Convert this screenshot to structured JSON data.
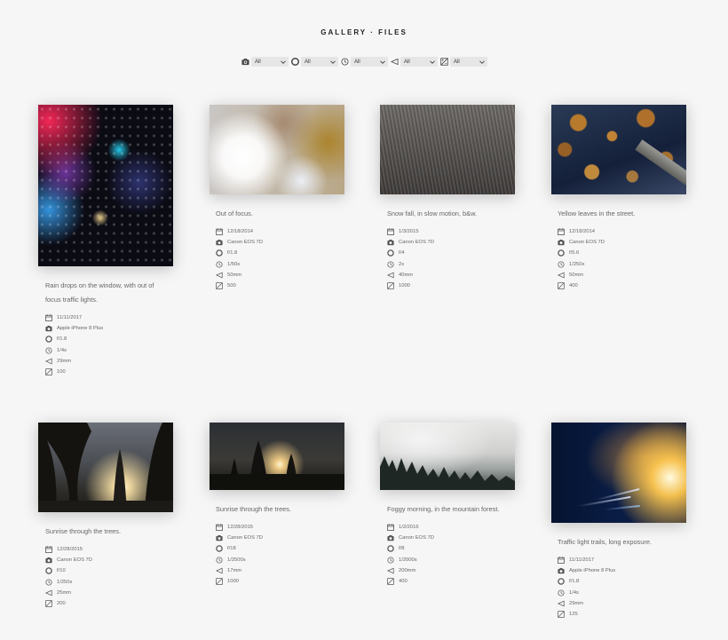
{
  "page": {
    "title": "GALLERY · FILES"
  },
  "filters": [
    {
      "icon": "camera-icon",
      "value": "All"
    },
    {
      "icon": "aperture-icon",
      "value": "All"
    },
    {
      "icon": "timer-icon",
      "value": "All"
    },
    {
      "icon": "focal-length-icon",
      "value": "All"
    },
    {
      "icon": "iso-icon",
      "value": "All"
    }
  ],
  "photos": [
    {
      "caption": "Rain drops on the window, with out of focus traffic lights.",
      "date": "11/11/2017",
      "camera": "Apple iPhone 8 Plus",
      "aperture": "f/1.8",
      "shutter": "1/4s",
      "focal": "29mm",
      "iso": "100"
    },
    {
      "caption": "Out of focus.",
      "date": "12/18/2014",
      "camera": "Canon EOS 7D",
      "aperture": "f/1.8",
      "shutter": "1/50s",
      "focal": "50mm",
      "iso": "500"
    },
    {
      "caption": "Snow fall, in slow motion, b&w.",
      "date": "1/3/2015",
      "camera": "Canon EOS 7D",
      "aperture": "f/4",
      "shutter": "2s",
      "focal": "40mm",
      "iso": "1000"
    },
    {
      "caption": "Yellow leaves in the street.",
      "date": "12/18/2014",
      "camera": "Canon EOS 7D",
      "aperture": "f/5.6",
      "shutter": "1/250s",
      "focal": "50mm",
      "iso": "400"
    },
    {
      "caption": "Sunrise through the trees.",
      "date": "12/28/2015",
      "camera": "Canon EOS 7D",
      "aperture": "f/10",
      "shutter": "1/250s",
      "focal": "25mm",
      "iso": "200"
    },
    {
      "caption": "Sunrise through the trees.",
      "date": "12/28/2015",
      "camera": "Canon EOS 7D",
      "aperture": "f/18",
      "shutter": "1/2500s",
      "focal": "17mm",
      "iso": "1000"
    },
    {
      "caption": "Foggy morning, in the mountain forest.",
      "date": "1/2/2016",
      "camera": "Canon EOS 7D",
      "aperture": "f/8",
      "shutter": "1/2000s",
      "focal": "200mm",
      "iso": "400"
    },
    {
      "caption": "Traffic light trails, long exposure.",
      "date": "11/11/2017",
      "camera": "Apple iPhone 8 Plus",
      "aperture": "f/1.8",
      "shutter": "1/4s",
      "focal": "29mm",
      "iso": "125"
    }
  ]
}
